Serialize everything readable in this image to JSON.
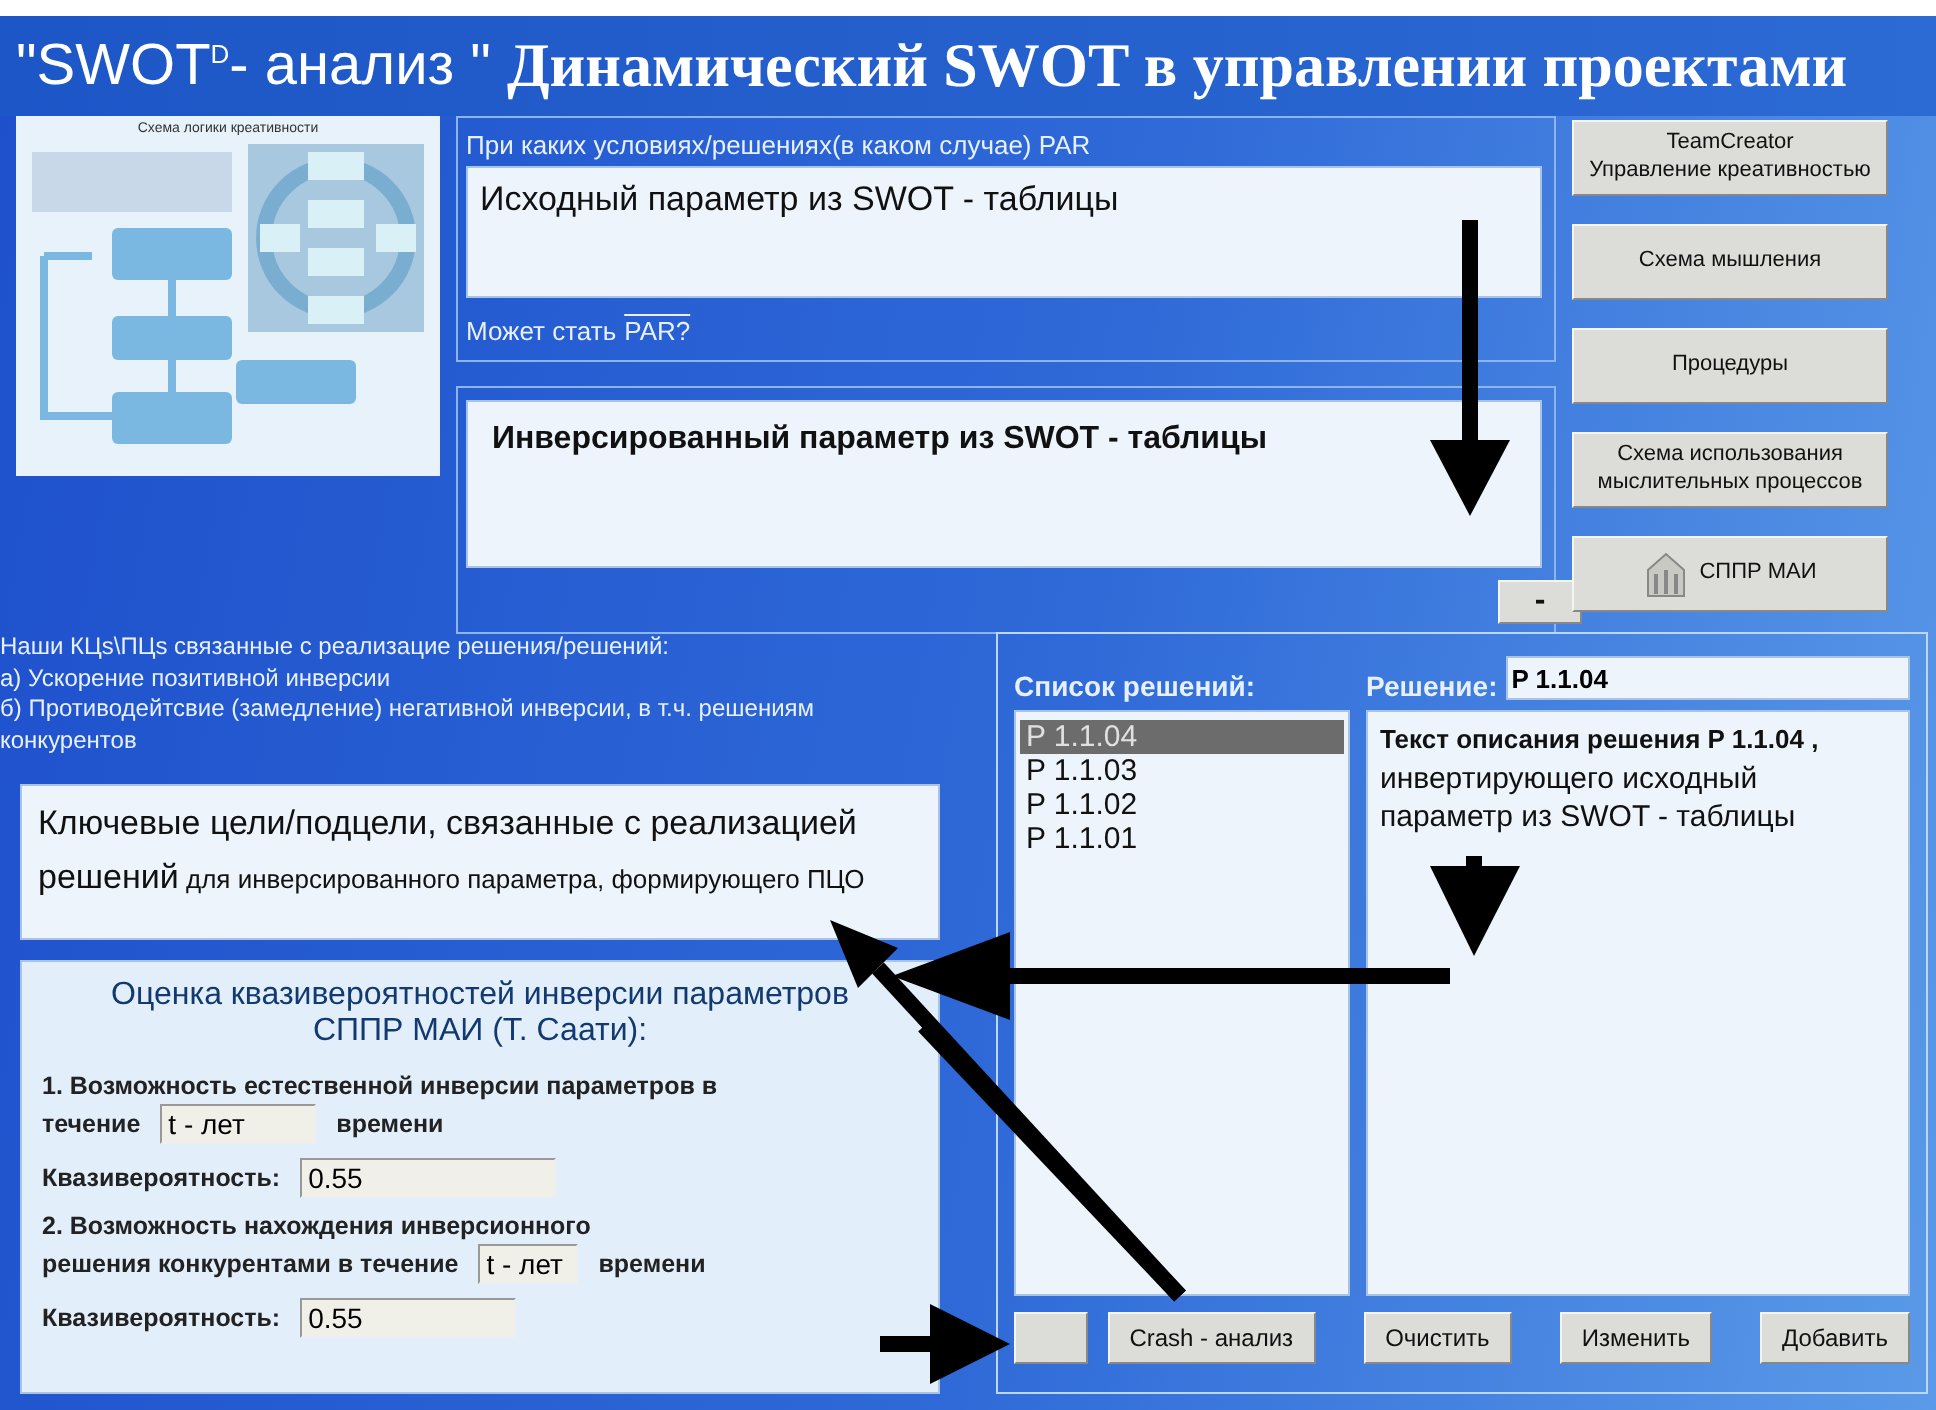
{
  "header": {
    "brand": "\"SWOT$^{D}$- анализ \"",
    "title": "Динамический SWOT в управлении проектами"
  },
  "diagram": {
    "title": "Схема логики креативности"
  },
  "condition_panel": {
    "label": "При каких условиях/решениях(в каком случае) PAR",
    "value": "Исходный параметр из SWOT - таблицы",
    "footer_label": "Может стать",
    "footer_overlined": "PAR?"
  },
  "inverted_panel": {
    "value": "Инверсированный параметр из SWOT - таблицы",
    "button": "-"
  },
  "side_buttons": [
    {
      "kind": "plain",
      "label": "TeamCreator\nУправление креативностью"
    },
    {
      "kind": "plain",
      "label": "Схема мышления"
    },
    {
      "kind": "plain",
      "label": "Процедуры"
    },
    {
      "kind": "plain",
      "label": "Схема использования\nмыслительных процессов"
    },
    {
      "kind": "icon",
      "label": "СППР МАИ"
    }
  ],
  "goals_intro": [
    "Наши КЦs\\ПЦs связанные с реализацие решения/решений:",
    "а) Ускорение позитивной инверсии",
    "б) Противодейтсвие (замедление) негативной инверсии, в т.ч. решениям конкурентов"
  ],
  "goals_box": {
    "lead": "Ключевые цели/подцели, связанные с реализацией решений",
    "rest": "для инверсированного параметра, формирующего ПЦО"
  },
  "evaluation": {
    "title": "Оценка квазивероятностей инверсии параметров СППР МАИ (Т. Саати):",
    "items": [
      {
        "line": "1. Возможность естественной инверсии параметров в",
        "text_before": "течение",
        "period": "t - лет",
        "text_after": "времени",
        "prob_label": "Квазивероятность:",
        "prob": "0.55"
      },
      {
        "line": "2. Возможность нахождения инверсионного",
        "text_before": "решения конкурентами в течение",
        "period": "t - лет",
        "text_after": "времени",
        "prob_label": "Квазивероятность:",
        "prob": "0.55"
      }
    ]
  },
  "solutions": {
    "list_label": "Список решений:",
    "solution_label": "Решение:",
    "solution_value": "P 1.1.04",
    "items": [
      {
        "label": "P 1.1.04",
        "selected": true
      },
      {
        "label": "P 1.1.03",
        "selected": false
      },
      {
        "label": "P 1.1.02",
        "selected": false
      },
      {
        "label": "P 1.1.01",
        "selected": false
      }
    ],
    "description": "**Текст описания решения P 1.1.04 ,** инвертирующего исходный параметр из SWOT - таблицы",
    "buttons": [
      "Crash - анализ",
      "Очистить",
      "Изменить",
      "Добавить"
    ]
  }
}
